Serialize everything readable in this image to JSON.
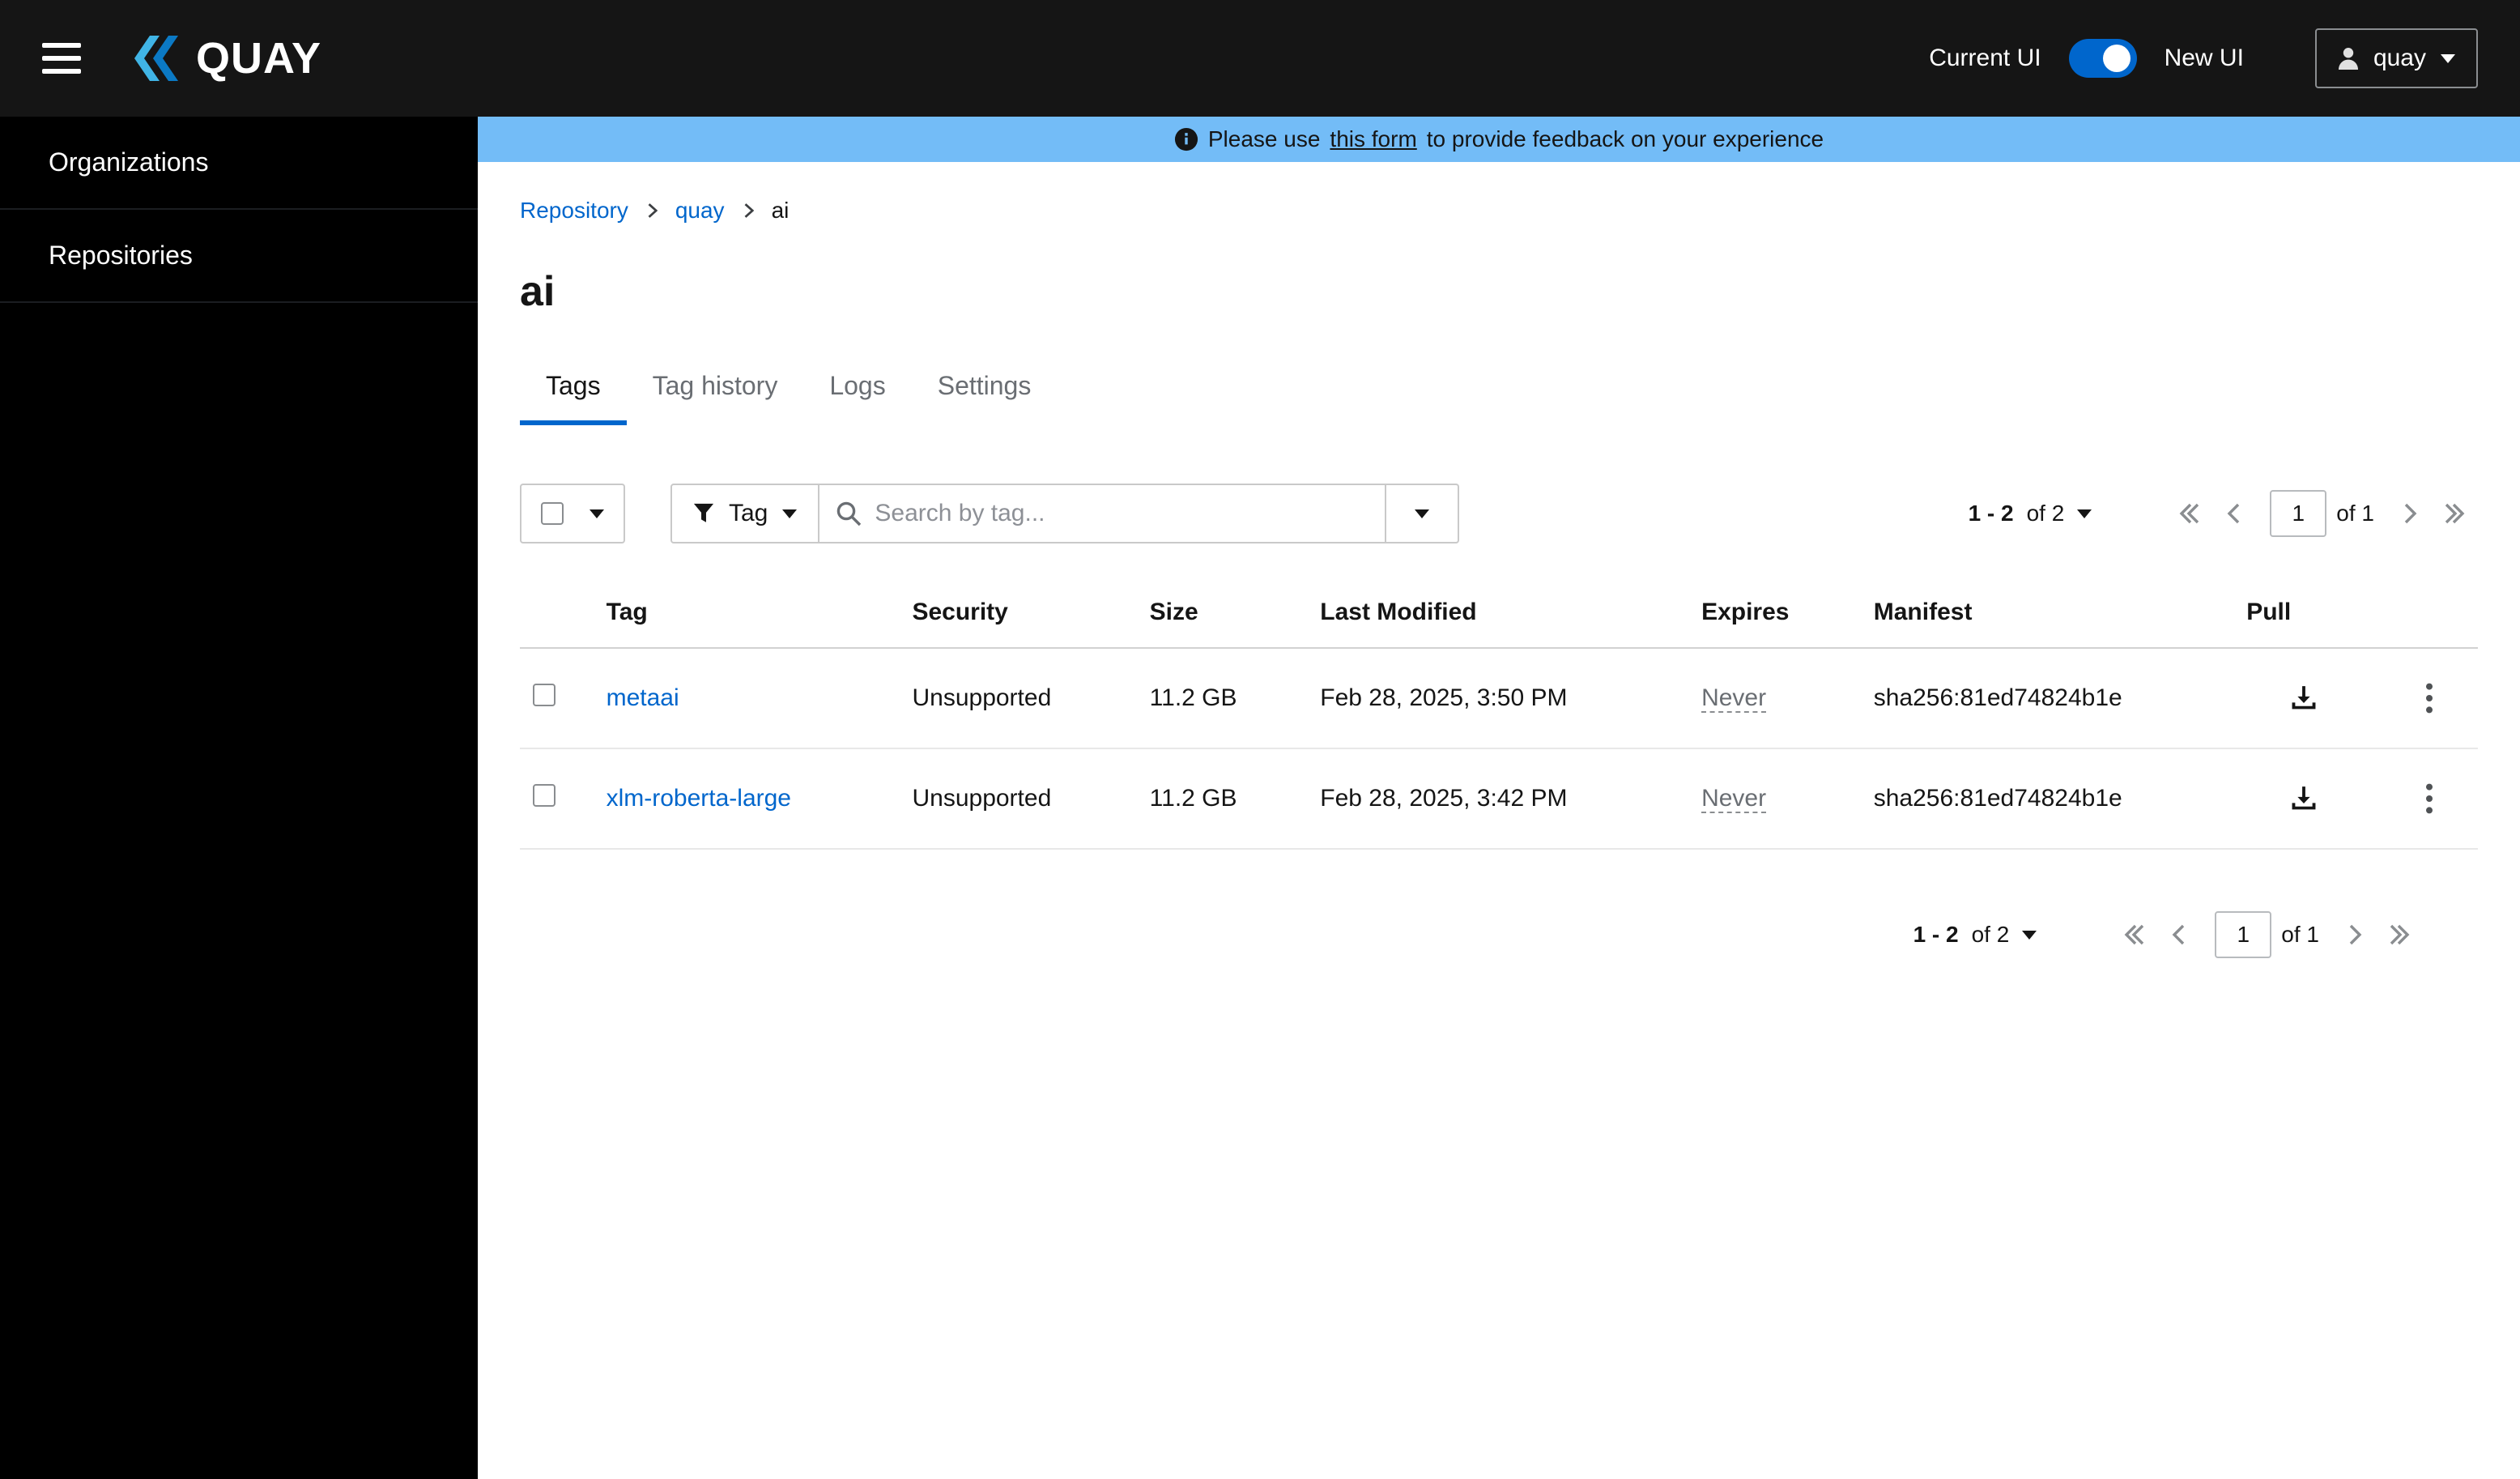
{
  "colors": {
    "accent": "#0066cc",
    "masthead_bg": "#151515",
    "sidebar_bg": "#000000",
    "banner_bg": "#73bcf7",
    "link": "#0066cc"
  },
  "header": {
    "brand": "QUAY",
    "current_ui_label": "Current UI",
    "new_ui_label": "New UI",
    "user_menu_label": "quay"
  },
  "sidebar": {
    "items": [
      {
        "label": "Organizations"
      },
      {
        "label": "Repositories"
      }
    ]
  },
  "banner": {
    "text_before": "Please use",
    "link_text": "this form",
    "text_after": "to provide feedback on your experience"
  },
  "breadcrumb": {
    "items": [
      {
        "label": "Repository"
      },
      {
        "label": "quay"
      },
      {
        "label": "ai"
      }
    ]
  },
  "page": {
    "title": "ai"
  },
  "tabs": [
    {
      "label": "Tags"
    },
    {
      "label": "Tag history"
    },
    {
      "label": "Logs"
    },
    {
      "label": "Settings"
    }
  ],
  "toolbar": {
    "filter_label": "Tag",
    "search_placeholder": "Search by tag...",
    "pagination": {
      "range": "1 - 2",
      "of_total": "of 2",
      "page": "1",
      "of_pages": "of 1"
    }
  },
  "table": {
    "columns": [
      "Tag",
      "Security",
      "Size",
      "Last Modified",
      "Expires",
      "Manifest",
      "Pull"
    ],
    "rows": [
      {
        "tag": "metaai",
        "security": "Unsupported",
        "size": "11.2 GB",
        "last_modified": "Feb 28, 2025, 3:50 PM",
        "expires": "Never",
        "manifest": "sha256:81ed74824b1e"
      },
      {
        "tag": "xlm-roberta-large",
        "security": "Unsupported",
        "size": "11.2 GB",
        "last_modified": "Feb 28, 2025, 3:42 PM",
        "expires": "Never",
        "manifest": "sha256:81ed74824b1e"
      }
    ]
  }
}
